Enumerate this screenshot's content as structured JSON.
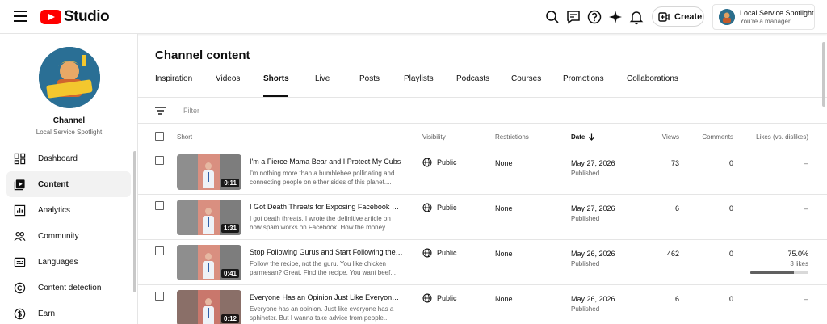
{
  "header": {
    "logo_text": "Studio",
    "create_label": "Create",
    "account_name": "Local Service Spotlight",
    "account_role": "You're a manager"
  },
  "sidebar": {
    "channel_title": "Channel",
    "channel_name": "Local Service Spotlight",
    "items": [
      {
        "label": "Dashboard",
        "icon": "dashboard-icon"
      },
      {
        "label": "Content",
        "icon": "content-icon",
        "active": true
      },
      {
        "label": "Analytics",
        "icon": "analytics-icon"
      },
      {
        "label": "Community",
        "icon": "community-icon"
      },
      {
        "label": "Languages",
        "icon": "languages-icon"
      },
      {
        "label": "Content detection",
        "icon": "copyright-icon"
      },
      {
        "label": "Earn",
        "icon": "dollar-icon"
      }
    ]
  },
  "main": {
    "title": "Channel content",
    "tabs": [
      "Inspiration",
      "Videos",
      "Shorts",
      "Live",
      "Posts",
      "Playlists",
      "Podcasts",
      "Courses",
      "Promotions",
      "Collaborations"
    ],
    "active_tab": "Shorts",
    "filter_placeholder": "Filter",
    "columns": {
      "short": "Short",
      "visibility": "Visibility",
      "restrictions": "Restrictions",
      "date": "Date",
      "views": "Views",
      "comments": "Comments",
      "likes": "Likes (vs. dislikes)"
    },
    "rows": [
      {
        "duration": "0:11",
        "title": "I'm a Fierce Mama Bear and I Protect My Cubs",
        "desc": "I'm nothing more than a bumblebee pollinating and connecting people on either sides of this planet....",
        "visibility": "Public",
        "restrictions": "None",
        "date": "May 27, 2026",
        "status": "Published",
        "views": "73",
        "comments": "0",
        "likes": "–"
      },
      {
        "duration": "1:31",
        "title": "I Got Death Threats for Exposing Facebook Spam",
        "desc": "I got death threats. I wrote the definitive article on how spam works on Facebook. How the money...",
        "visibility": "Public",
        "restrictions": "None",
        "date": "May 27, 2026",
        "status": "Published",
        "views": "6",
        "comments": "0",
        "likes": "–"
      },
      {
        "duration": "0:41",
        "title": "Stop Following Gurus and Start Following the Recipe",
        "desc": "Follow the recipe, not the guru. You like chicken parmesan? Great. Find the recipe. You want beef...",
        "visibility": "Public",
        "restrictions": "None",
        "date": "May 26, 2026",
        "status": "Published",
        "views": "462",
        "comments": "0",
        "likes": "75.0%",
        "likes_sub": "3 likes",
        "likes_fraction": 0.75
      },
      {
        "duration": "0:12",
        "title": "Everyone Has an Opinion Just Like Everyone Has a Sphincter",
        "desc": "Everyone has an opinion. Just like everyone has a sphincter. But I wanna take advice from people...",
        "visibility": "Public",
        "restrictions": "None",
        "date": "May 26, 2026",
        "status": "Published",
        "views": "6",
        "comments": "0",
        "likes": "–"
      }
    ]
  }
}
